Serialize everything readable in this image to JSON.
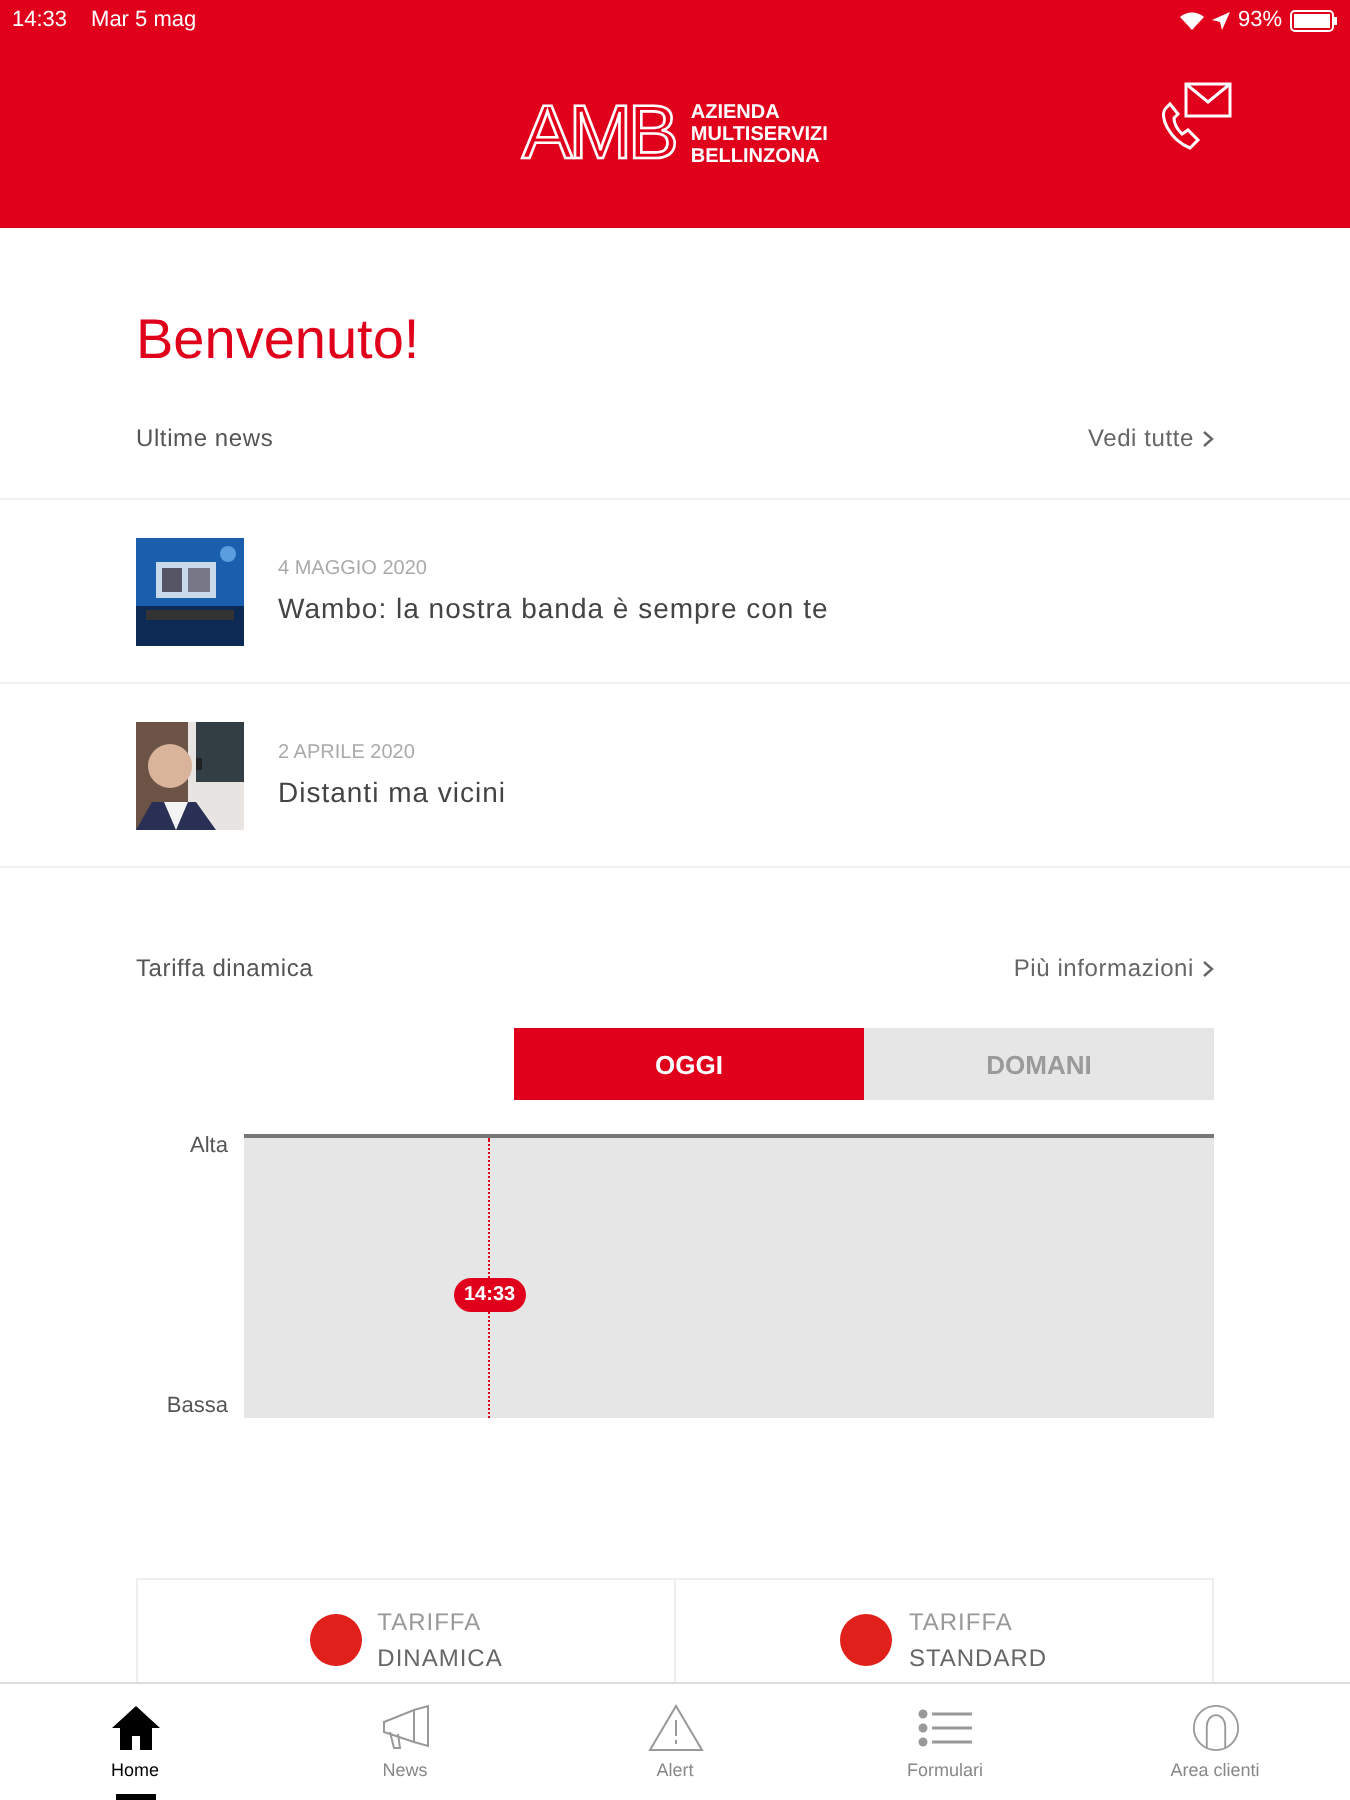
{
  "status_bar": {
    "time": "14:33",
    "date": "Mar 5 mag",
    "battery": "93%"
  },
  "header": {
    "logo": "AMB",
    "logo_lines": [
      "AZIENDA",
      "MULTISERVIZI",
      "BELLINZONA"
    ]
  },
  "welcome": "Benvenuto!",
  "news": {
    "title": "Ultime news",
    "link": "Vedi tutte",
    "items": [
      {
        "date": "4 MAGGIO 2020",
        "title": "Wambo: la nostra banda è sempre con te",
        "kind": "picture"
      },
      {
        "date": "2 APRILE 2020",
        "title": "Distanti ma vicini",
        "kind": "picture"
      }
    ]
  },
  "tariff": {
    "title": "Tariffa dinamica",
    "link": "Più informazioni",
    "tabs": [
      {
        "label": "OGGI",
        "selected": true
      },
      {
        "label": "DOMANI",
        "selected": false
      }
    ],
    "axis": {
      "top": "Alta",
      "bottom": "Bassa"
    },
    "now": "14:33",
    "legend": [
      {
        "line1": "TARIFFA",
        "line2": "DINAMICA",
        "color": "#e0201b"
      },
      {
        "line1": "TARIFFA",
        "line2": "STANDARD",
        "color": "#e0201b"
      }
    ]
  },
  "nav": [
    {
      "label": "Home",
      "kind": "home",
      "selected": true
    },
    {
      "label": "News",
      "kind": "megaphone",
      "selected": false
    },
    {
      "label": "Alert",
      "kind": "alert",
      "selected": false
    },
    {
      "label": "Formulari",
      "kind": "list",
      "selected": false
    },
    {
      "label": "Area clienti",
      "kind": "user",
      "selected": false
    }
  ]
}
